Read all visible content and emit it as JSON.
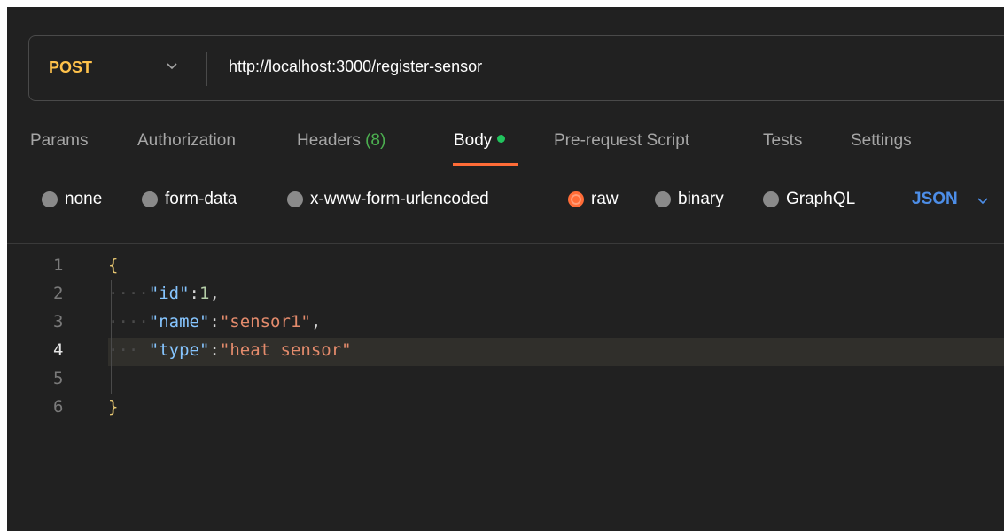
{
  "request": {
    "method": "POST",
    "url": "http://localhost:3000/register-sensor"
  },
  "tabs": [
    {
      "label": "Params"
    },
    {
      "label": "Authorization"
    },
    {
      "label": "Headers",
      "count": "(8)"
    },
    {
      "label": "Body"
    },
    {
      "label": "Pre-request Script"
    },
    {
      "label": "Tests"
    },
    {
      "label": "Settings"
    }
  ],
  "body_types": [
    {
      "label": "none"
    },
    {
      "label": "form-data"
    },
    {
      "label": "x-www-form-urlencoded"
    },
    {
      "label": "raw",
      "selected": true
    },
    {
      "label": "binary"
    },
    {
      "label": "GraphQL"
    }
  ],
  "format": "JSON",
  "editor": {
    "line_numbers": [
      "1",
      "2",
      "3",
      "4",
      "5",
      "6"
    ],
    "current_line": 4,
    "open_brace": "{",
    "close_brace": "}",
    "id_key": "\"id\"",
    "id_value": "1",
    "name_key": "\"name\"",
    "name_value": "\"sensor1\"",
    "type_key": "\"type\"",
    "type_value": "\"heat sensor\""
  },
  "colors": {
    "accent": "#ff6c37",
    "method": "#ffc24b",
    "format": "#4d8ee8",
    "status_dot": "#21c45d"
  }
}
